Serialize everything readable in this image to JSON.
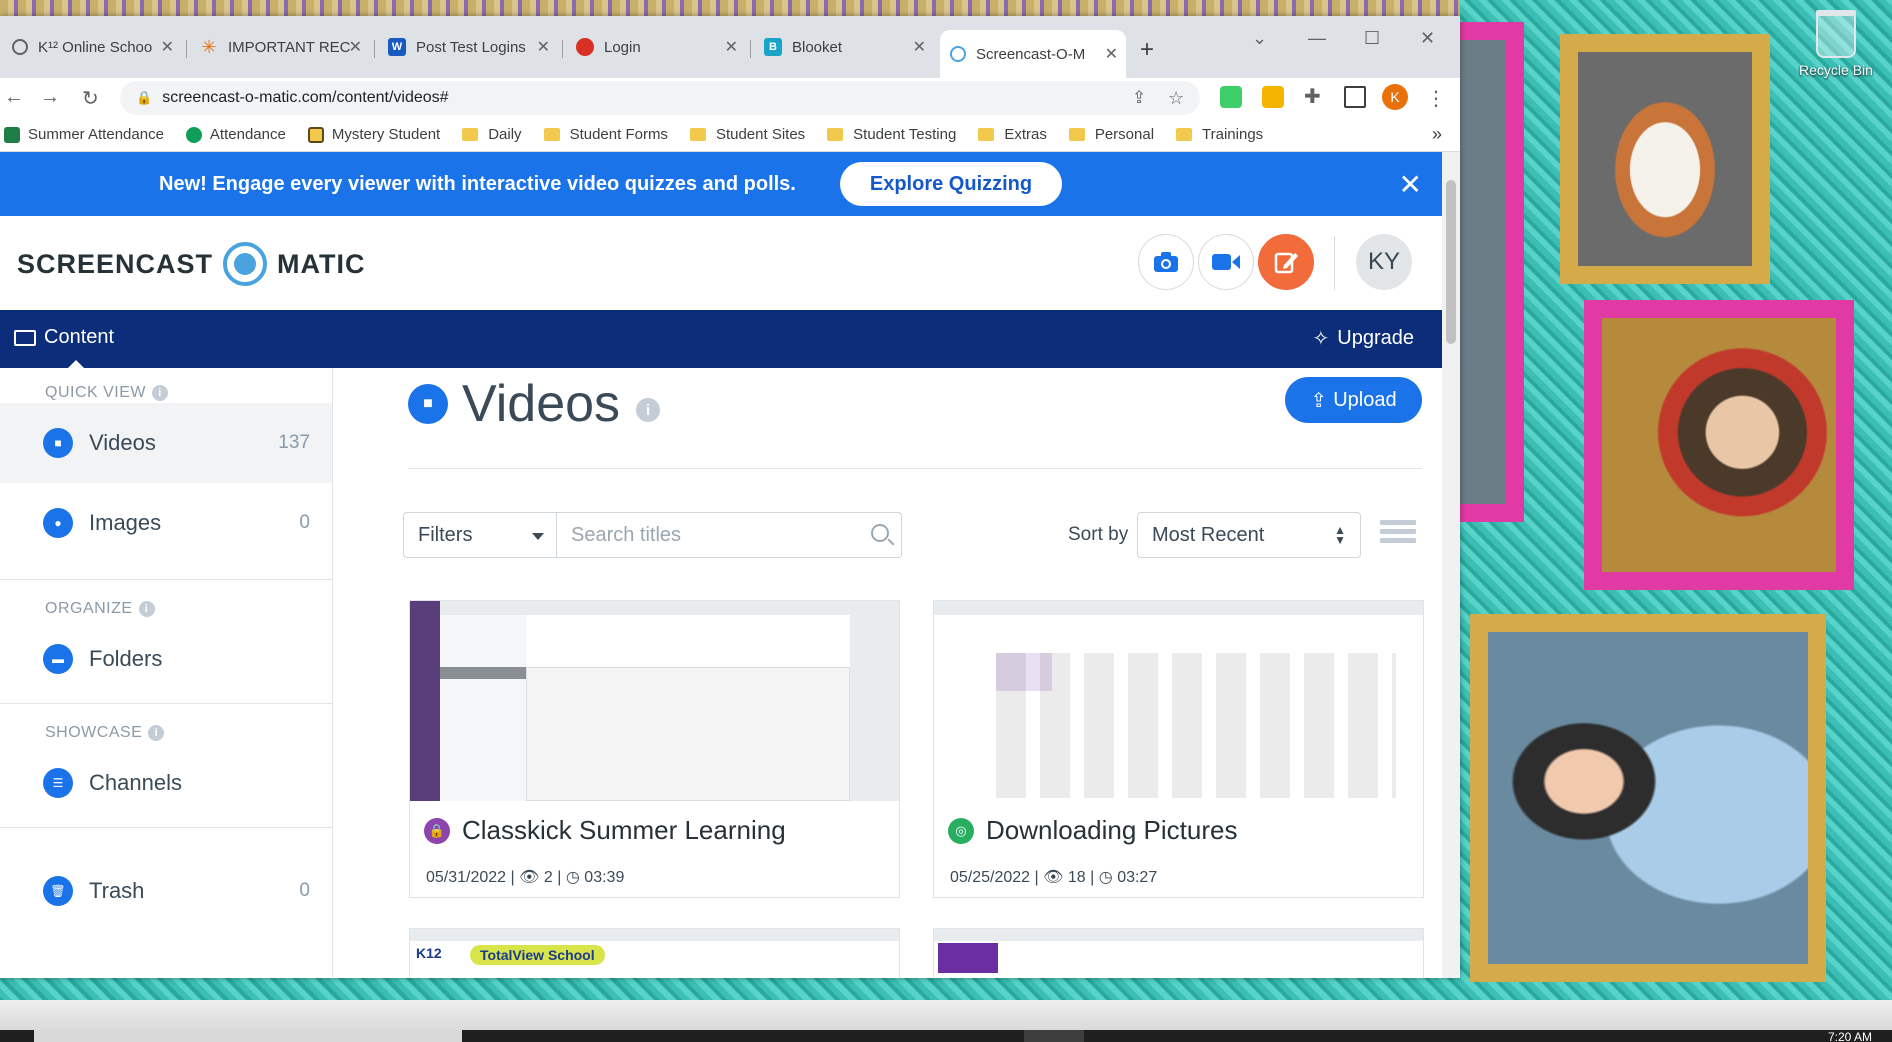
{
  "browser": {
    "tabs": [
      {
        "label": "K¹² Online Schoo",
        "icon": "globe-icon",
        "color": "#5f6368"
      },
      {
        "label": "IMPORTANT REC",
        "icon": "asterisk-icon",
        "color": "#e8710a"
      },
      {
        "label": "Post Test Logins",
        "icon": "word-icon",
        "color": "#185abd"
      },
      {
        "label": "Login",
        "icon": "red-circle-icon",
        "color": "#d93025"
      },
      {
        "label": "Blooket",
        "icon": "blooket-icon",
        "color": "#1aa3c8"
      },
      {
        "label": "Screencast-O-M",
        "icon": "screencast-icon",
        "color": "#4aa3df"
      }
    ],
    "url": "screencast-o-matic.com/content/videos#",
    "profile_initial": "K",
    "bookmarks": [
      {
        "label": "Summer Attendance",
        "type": "excel"
      },
      {
        "label": "Attendance",
        "type": "sheets"
      },
      {
        "label": "Mystery Student",
        "type": "app"
      },
      {
        "label": "Daily",
        "type": "folder"
      },
      {
        "label": "Student Forms",
        "type": "folder"
      },
      {
        "label": "Student Sites",
        "type": "folder"
      },
      {
        "label": "Student Testing",
        "type": "folder"
      },
      {
        "label": "Extras",
        "type": "folder"
      },
      {
        "label": "Personal",
        "type": "folder"
      },
      {
        "label": "Trainings",
        "type": "folder"
      }
    ],
    "bookmarks_more": "»"
  },
  "banner": {
    "text": "New! Engage every viewer with interactive video quizzes and polls.",
    "button": "Explore Quizzing",
    "close": "✕"
  },
  "header": {
    "logo_left": "SCREENCAST",
    "logo_right": "MATIC",
    "avatar": "KY"
  },
  "navbar": {
    "content": "Content",
    "upgrade": "Upgrade"
  },
  "sidebar": {
    "quick_view": "QUICK VIEW",
    "organize": "ORGANIZE",
    "showcase": "SHOWCASE",
    "items": [
      {
        "label": "Videos",
        "count": "137"
      },
      {
        "label": "Images",
        "count": "0"
      },
      {
        "label": "Folders",
        "count": ""
      },
      {
        "label": "Channels",
        "count": ""
      },
      {
        "label": "Trash",
        "count": "0"
      }
    ]
  },
  "main": {
    "title": "Videos",
    "upload": "Upload",
    "filters": "Filters",
    "search_placeholder": "Search titles",
    "sort_label": "Sort by",
    "sort_value": "Most Recent",
    "cards": [
      {
        "title": "Classkick Summer Learning",
        "date": "05/31/2022",
        "views": "2",
        "duration": "03:39",
        "badge_color": "#8e44ad"
      },
      {
        "title": "Downloading Pictures",
        "date": "05/25/2022",
        "views": "18",
        "duration": "03:27",
        "badge_color": "#27ae60"
      }
    ],
    "next_card_text": "TotalView School"
  },
  "desktop": {
    "recycle_bin": "Recycle Bin",
    "clock": "7:20 AM"
  }
}
